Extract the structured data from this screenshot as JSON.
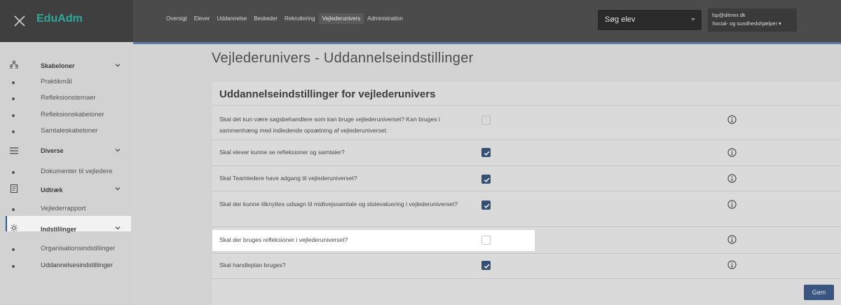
{
  "app": {
    "brand": "EduAdm"
  },
  "topnav": [
    {
      "label": "Oversigt",
      "active": false
    },
    {
      "label": "Elever",
      "active": false
    },
    {
      "label": "Uddannelse",
      "active": false
    },
    {
      "label": "Beskeder",
      "active": false
    },
    {
      "label": "Rekruttering",
      "active": false
    },
    {
      "label": "Vejlederunivers",
      "active": true
    },
    {
      "label": "Administration",
      "active": false
    }
  ],
  "search": {
    "placeholder": "Søg elev"
  },
  "user": {
    "email": "lsp@ditmer.dk",
    "role": "Social- og sundhedshjælper ▾"
  },
  "sidebar": {
    "groups": [
      {
        "label": "Skabeloner",
        "icon": "people-icon",
        "items": [
          "Praktikmål",
          "Refleksionstemaer",
          "Refleksionskabeloner",
          "Samtaleskabeloner"
        ]
      },
      {
        "label": "Diverse",
        "icon": "list-icon",
        "items": [
          "Dokumenter til vejledere"
        ]
      },
      {
        "label": "Udtræk",
        "icon": "document-icon",
        "items": [
          "Vejlederrapport"
        ]
      },
      {
        "label": "Indstillinger",
        "icon": "settings-icon",
        "items": [
          "Organisationsindstillinger",
          "Uddannelsesindstillinger"
        ]
      }
    ],
    "active_item": "Uddannelsesindstillinger"
  },
  "page": {
    "title": "Vejlederunivers - Uddannelseindstillinger",
    "panel_title": "Uddannelseindstillinger for vejlederunivers"
  },
  "settings": [
    {
      "question": "Skal det kun være sagsbehandlere som kan bruge vejlederuniverset? Kan bruges i sammenhæng med indledende opsætning af vejlederuniverset.",
      "checked": false
    },
    {
      "question": "Skal elever kunne se refleksioner og samtaler?",
      "checked": true
    },
    {
      "question": "Skal Teamledere have adgang til vejlederuniverset?",
      "checked": true
    },
    {
      "question": "Skal der kunne tilknyttes udsagn til midtvejssamtale og slutevaluering i vejlederuniverset?",
      "checked": true
    },
    {
      "question": "Skal der bruges refleksioner i vejlederuniverset?",
      "checked": false
    },
    {
      "question": "Skal handleplan bruges?",
      "checked": true
    }
  ],
  "actions": {
    "save_label": "Gem"
  },
  "colors": {
    "brand": "#2fa89c",
    "accent": "#354f76",
    "topbar": "#4b4b4b"
  }
}
